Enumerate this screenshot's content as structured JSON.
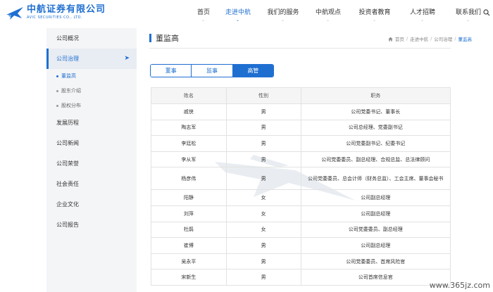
{
  "header": {
    "logo_cn": "中航证券有限公司",
    "logo_en": "AVIC SECURITIES CO., LTD.",
    "nav": [
      {
        "label": "首页",
        "active": false
      },
      {
        "label": "走进中航",
        "active": true
      },
      {
        "label": "我们的服务",
        "active": false
      },
      {
        "label": "中航观点",
        "active": false
      },
      {
        "label": "投资者教育",
        "active": false
      },
      {
        "label": "人才招聘",
        "active": false
      },
      {
        "label": "联系我们",
        "active": false
      }
    ]
  },
  "sidebar": {
    "items": [
      {
        "label": "公司概况"
      },
      {
        "label": "公司治理"
      },
      {
        "label": "发展历程"
      },
      {
        "label": "公司新闻"
      },
      {
        "label": "公司荣誉"
      },
      {
        "label": "社会责任"
      },
      {
        "label": "企业文化"
      },
      {
        "label": "公司报告"
      }
    ],
    "sub_items": [
      {
        "label": "董监高"
      },
      {
        "label": "股东介绍"
      },
      {
        "label": "股权分布"
      }
    ]
  },
  "main": {
    "title": "董监高",
    "breadcrumb": [
      "首页",
      "走进中航",
      "公司治理",
      "董监高"
    ],
    "tabs": [
      "董事",
      "监事",
      "高管"
    ],
    "table": {
      "headers": [
        "姓名",
        "性别",
        "职务"
      ],
      "rows": [
        [
          "戚侠",
          "男",
          "公司党委书记、董事长"
        ],
        [
          "陶志军",
          "男",
          "公司总经理、党委副书记"
        ],
        [
          "李廷松",
          "男",
          "公司党委副书记、纪委书记"
        ],
        [
          "李从军",
          "男",
          "公司党委委员、副总经理、合规总监、总法律顾问"
        ],
        [
          "杨彦伟",
          "男",
          "公司党委委员、总会计师（财务总监）、工会主席、董事会秘书"
        ],
        [
          "阳静",
          "女",
          "公司副总经理"
        ],
        [
          "刘萍",
          "女",
          "公司副总经理"
        ],
        [
          "杜鹃",
          "女",
          "公司党委委员、副总经理"
        ],
        [
          "崔博",
          "男",
          "公司副总经理"
        ],
        [
          "吴永平",
          "男",
          "公司党委委员、首席风险官"
        ],
        [
          "宋新生",
          "男",
          "公司首席信息官"
        ]
      ]
    }
  },
  "watermark_text": "www.365jz.com",
  "colors": {
    "accent": "#1f6fd1",
    "sidebar_bg": "#f4f5f7"
  }
}
